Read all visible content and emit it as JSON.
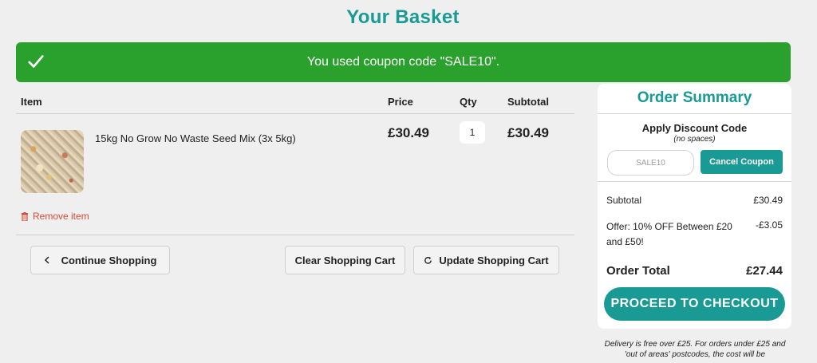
{
  "page_title": "Your Basket",
  "alert": {
    "message": "You used coupon code \"SALE10\"."
  },
  "cart": {
    "headers": {
      "item": "Item",
      "price": "Price",
      "qty": "Qty",
      "subtotal": "Subtotal"
    },
    "items": [
      {
        "name": "15kg No Grow No Waste Seed Mix (3x 5kg)",
        "price": "£30.49",
        "qty": "1",
        "subtotal": "£30.49",
        "remove_label": "Remove item"
      }
    ]
  },
  "buttons": {
    "continue": "Continue Shopping",
    "clear": "Clear Shopping Cart",
    "update": "Update Shopping Cart"
  },
  "summary": {
    "title": "Order Summary",
    "discount_title": "Apply Discount Code",
    "discount_note": "(no spaces)",
    "coupon_value": "SALE10",
    "cancel_coupon": "Cancel Coupon",
    "subtotal_label": "Subtotal",
    "subtotal_value": "£30.49",
    "offer_label": "Offer: 10% OFF Between £20 and £50!",
    "offer_value": "-£3.05",
    "total_label": "Order Total",
    "total_value": "£27.44",
    "checkout": "PROCEED TO CHECKOUT"
  },
  "delivery_note": "Delivery is free over £25. For orders under £25 and 'out of areas' postcodes, the cost will be",
  "colors": {
    "accent": "#1a9a94",
    "success": "#2aa12c",
    "danger": "#d94a3a"
  }
}
